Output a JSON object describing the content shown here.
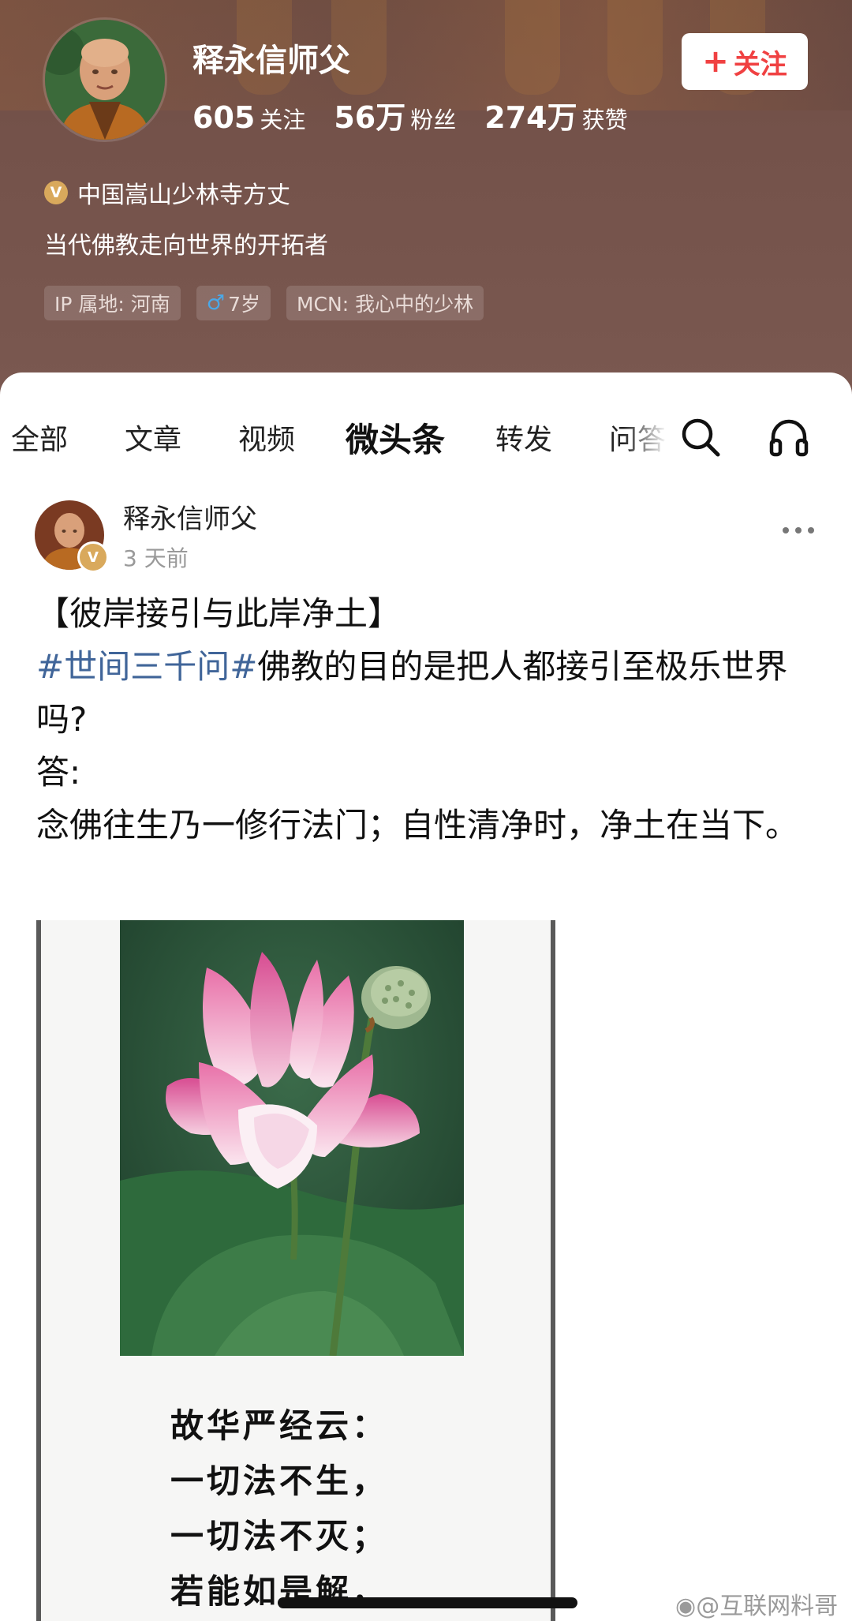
{
  "profile": {
    "name": "释永信师父",
    "follow_button": "关注",
    "stats": [
      {
        "num": "605",
        "label": "关注"
      },
      {
        "num": "56万",
        "label": "粉丝"
      },
      {
        "num": "274万",
        "label": "获赞"
      }
    ],
    "verified_title": "中国嵩山少林寺方丈",
    "bio": "当代佛教走向世界的开拓者",
    "tags": {
      "ip": "IP 属地: 河南",
      "age": "7岁",
      "mcn": "MCN: 我心中的少林"
    },
    "badge_letter": "V"
  },
  "tabs": [
    "全部",
    "文章",
    "视频",
    "微头条",
    "转发",
    "问答"
  ],
  "active_tab": "微头条",
  "post": {
    "author": "释永信师父",
    "time": "3 天前",
    "title": "【彼岸接引与此岸净土】",
    "hashtag": "#世间三千问#",
    "question": "佛教的目的是把人都接引至极乐世界吗?",
    "answer_label": "答:",
    "answer": "念佛往生乃一修行法门；自性清净时，净土在当下。",
    "image_poem": [
      "故华严经云：",
      "一切法不生，",
      "一切法不灭；",
      "若能如是解，"
    ]
  },
  "watermark": "@互联网料哥",
  "icons": [
    "plus-icon",
    "verified-icon",
    "male-icon",
    "search-icon",
    "headphones-icon",
    "more-icon",
    "weibo-icon"
  ],
  "colors": {
    "header_bg": "#74524a",
    "follow_text": "#f04142",
    "hashtag": "#406599",
    "verified_badge": "#d9a95c"
  }
}
